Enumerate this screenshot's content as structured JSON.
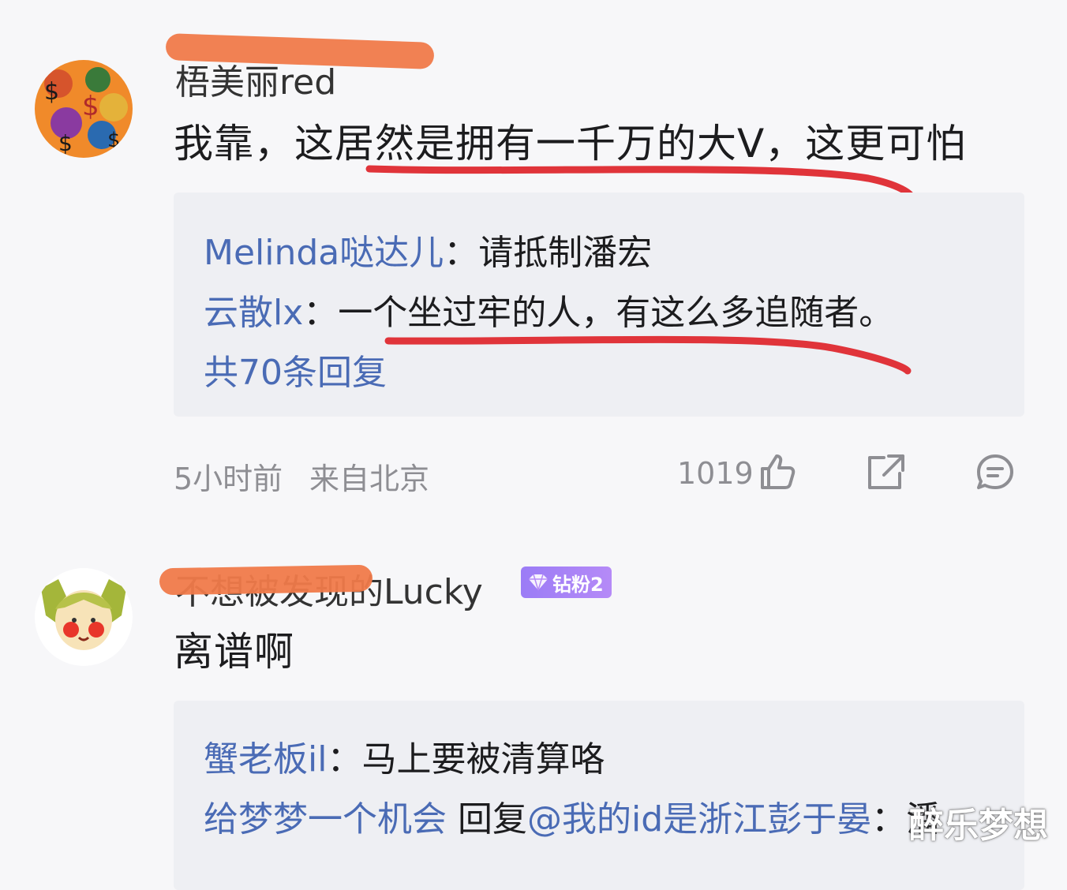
{
  "comments": [
    {
      "username": "梧美丽red",
      "text": "我靠，这居然是拥有一千万的大V，这更可怕",
      "replies": [
        {
          "name": "Melinda哒达儿",
          "sep": "：",
          "text": "请抵制潘宏"
        },
        {
          "name": "云散lx",
          "sep": "：",
          "text": "一个坐过牢的人，有这么多追随者。"
        }
      ],
      "more_replies": "共70条回复",
      "time": "5小时前",
      "location": "来自北京",
      "like_count": "1019"
    },
    {
      "username": "不想被发现的Lucky",
      "badge": "钻粉2",
      "text": "离谱啊",
      "replies": [
        {
          "name": "蟹老板il",
          "sep": "：",
          "text": "马上要被清算咯"
        },
        {
          "name": "给梦梦一个机会",
          "sep": " ",
          "text": "回复",
          "mention": "@我的id是浙江彭于晏",
          "tail": "：潘"
        }
      ]
    }
  ],
  "watermark": "醉乐梦想",
  "icons": {
    "like": "thumbs-up-icon",
    "share": "share-icon",
    "comment": "comment-icon",
    "badge": "diamond-icon"
  },
  "colors": {
    "link_blue": "#4a6bb5",
    "redact_orange": "#f07a4a",
    "underline_red": "#e0343a",
    "badge_purple": "#a07ff6"
  }
}
